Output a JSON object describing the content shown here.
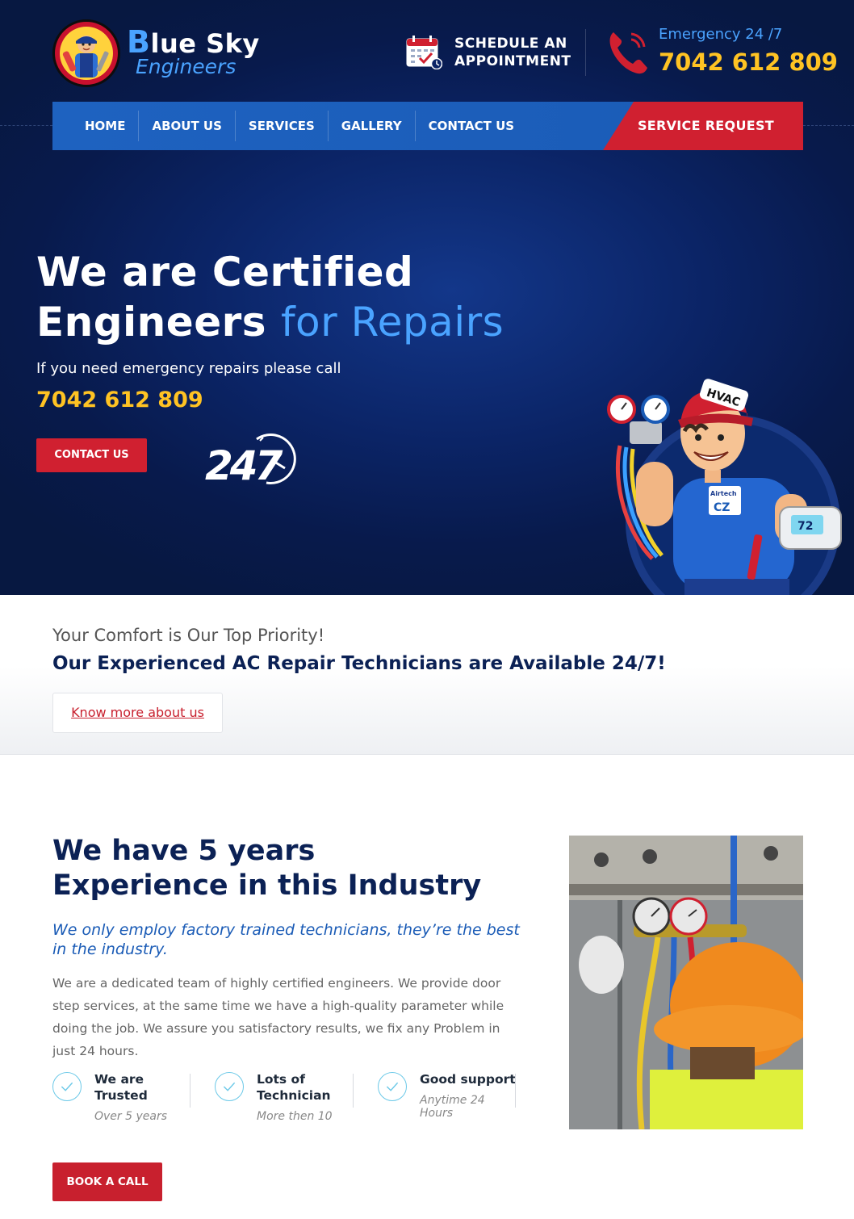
{
  "header": {
    "brand_first": "B",
    "brand_rest": "lue Sky",
    "brand_sub": "Engineers",
    "schedule_line1": "SCHEDULE AN",
    "schedule_line2": "APPOINTMENT",
    "emergency_label": "Emergency 24 /7",
    "emergency_number": "7042 612 809"
  },
  "nav": {
    "items": [
      "HOME",
      "ABOUT US",
      "SERVICES",
      "GALLERY",
      "CONTACT US"
    ],
    "service_request": "SERVICE REQUEST"
  },
  "hero": {
    "title_line1": "We are Certified",
    "title_line2_bold": "Engineers",
    "title_line2_accent": "for Repairs",
    "subtitle": "If you need emergency repairs please call",
    "phone": "7042 612 809",
    "contact_button": "CONTACT US",
    "badge_text": "247",
    "mascot_cap_text": "HVAC",
    "mascot_shirt_brand": "Airtech",
    "mascot_shirt_logo": "CZ",
    "thermostat_value": "72"
  },
  "priority": {
    "line1": "Your Comfort is Our Top Priority!",
    "line2": "Our Experienced AC Repair Technicians are Available 24/7!",
    "link": "Know more about us"
  },
  "experience": {
    "title_line1": "We have 5 years",
    "title_line2": "Experience in this Industry",
    "tagline": "We only employ factory trained technicians, they’re the best in the industry.",
    "body": "We are a dedicated team of highly certified engineers. We provide door step services, at the same time we have a high-quality parameter while doing the job. We assure you satisfactory results, we fix any Problem in just 24 hours.",
    "features": [
      {
        "title": "We are Trusted",
        "sub": "Over 5 years"
      },
      {
        "title": "Lots of Technician",
        "sub": "More then 10"
      },
      {
        "title": "Good support",
        "sub": "Anytime 24 Hours"
      }
    ],
    "book_button": "BOOK A CALL"
  },
  "colors": {
    "navy": "#0b2155",
    "hero_dark": "#071841",
    "nav_blue": "#1e62c0",
    "red": "#d02030",
    "gold": "#ffc323",
    "light_blue": "#4aa3ff"
  },
  "icons": [
    "technician-logo",
    "calendar-check-icon",
    "phone-icon",
    "check-circle-icon",
    "clock-24-icon"
  ]
}
